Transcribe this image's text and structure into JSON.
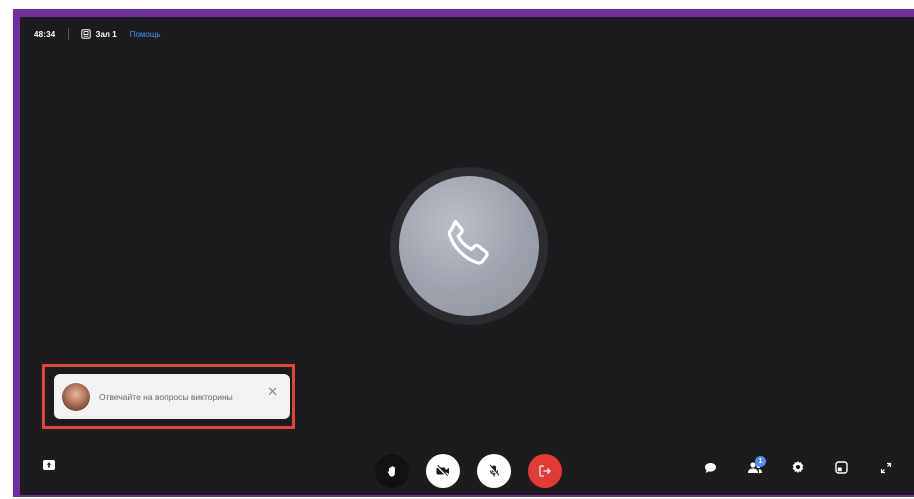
{
  "topbar": {
    "timer": "48:34",
    "room_label": "Зал 1",
    "help_link": "Помощь"
  },
  "center": {
    "icon": "phone-icon"
  },
  "notification": {
    "text": "Отвечайте на вопросы викторины",
    "close_symbol": "✕"
  },
  "controls": {
    "left": [
      "upload-icon"
    ],
    "center": [
      "raise-hand-icon",
      "camera-off-icon",
      "mic-off-icon",
      "leave-icon"
    ],
    "right": [
      "chat-icon",
      "participants-icon",
      "settings-icon",
      "layout-icon",
      "fullscreen-icon"
    ]
  },
  "participants_badge": "1",
  "colors": {
    "frame": "#6f2f9e",
    "background": "#1c1c1e",
    "accent": "#4e8ef7",
    "danger": "#e53935",
    "highlight_outline": "#d9473a"
  }
}
